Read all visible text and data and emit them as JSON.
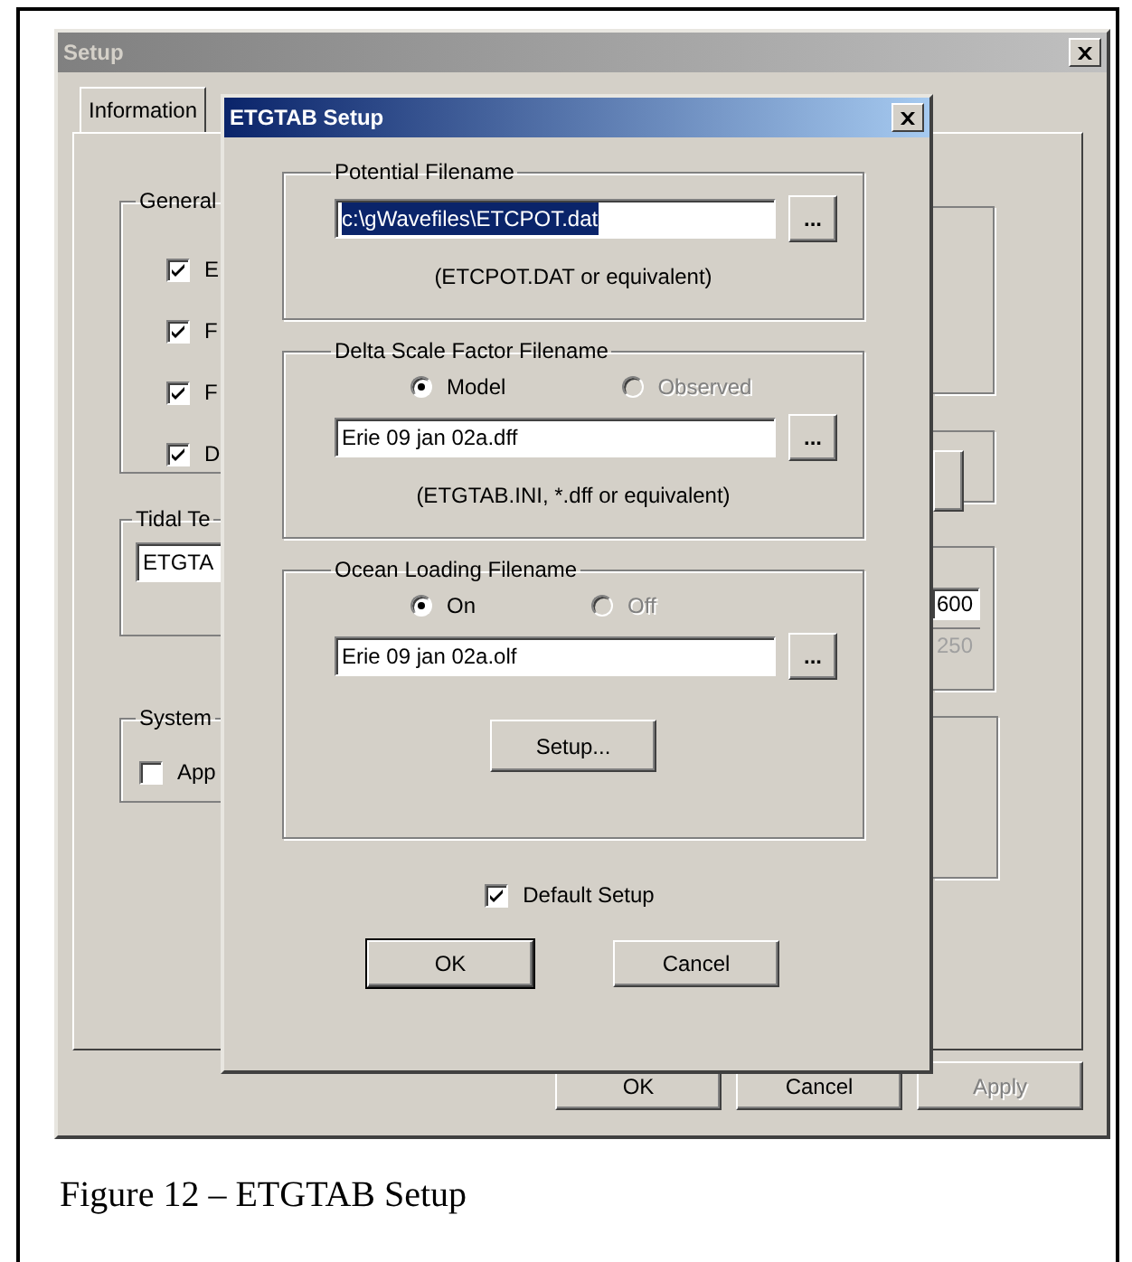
{
  "background_window": {
    "title": "Setup",
    "active": false,
    "tabs": [
      {
        "label": "Information",
        "selected": true
      }
    ],
    "general_group": {
      "label": "General",
      "checkboxes": [
        {
          "label": "E",
          "checked": true
        },
        {
          "label": "F",
          "checked": true
        },
        {
          "label": "F",
          "checked": true
        },
        {
          "label": "D",
          "checked": true
        }
      ]
    },
    "tidal_group": {
      "label": "Tidal Te",
      "field": "ETGTA"
    },
    "system_group": {
      "label": "System",
      "checkbox": {
        "label": "App",
        "checked": false
      }
    },
    "right_fields": [
      {
        "value": "600",
        "disabled": false
      },
      {
        "value": "250",
        "disabled": true
      }
    ],
    "buttons": [
      {
        "label": "OK",
        "disabled": false
      },
      {
        "label": "Cancel",
        "disabled": false
      },
      {
        "label": "Apply",
        "disabled": true
      }
    ]
  },
  "dialog": {
    "title": "ETGTAB Setup",
    "active": true,
    "groups": [
      {
        "label": "Potential Filename",
        "field": {
          "value": "c:\\gWavefiles\\ETCPOT.dat",
          "highlighted": true
        },
        "browse": "...",
        "hint": "(ETCPOT.DAT or equivalent)"
      },
      {
        "label": "Delta Scale Factor Filename",
        "radios": [
          {
            "label": "Model",
            "selected": true,
            "disabled": false
          },
          {
            "label": "Observed",
            "selected": false,
            "disabled": true
          }
        ],
        "field": {
          "value": "Erie 09 jan 02a.dff",
          "highlighted": false
        },
        "browse": "...",
        "hint": "(ETGTAB.INI, *.dff or equivalent)"
      },
      {
        "label": "Ocean Loading Filename",
        "radios": [
          {
            "label": "On",
            "selected": true,
            "disabled": false
          },
          {
            "label": "Off",
            "selected": false,
            "disabled": true
          }
        ],
        "field": {
          "value": "Erie 09 jan 02a.olf",
          "highlighted": false
        },
        "browse": "...",
        "setup_button": "Setup..."
      }
    ],
    "default_setup": {
      "label": "Default Setup",
      "checked": true
    },
    "buttons": [
      {
        "label": "OK",
        "default": true
      },
      {
        "label": "Cancel",
        "default": false
      }
    ]
  },
  "caption": "Figure 12 – ETGTAB Setup"
}
